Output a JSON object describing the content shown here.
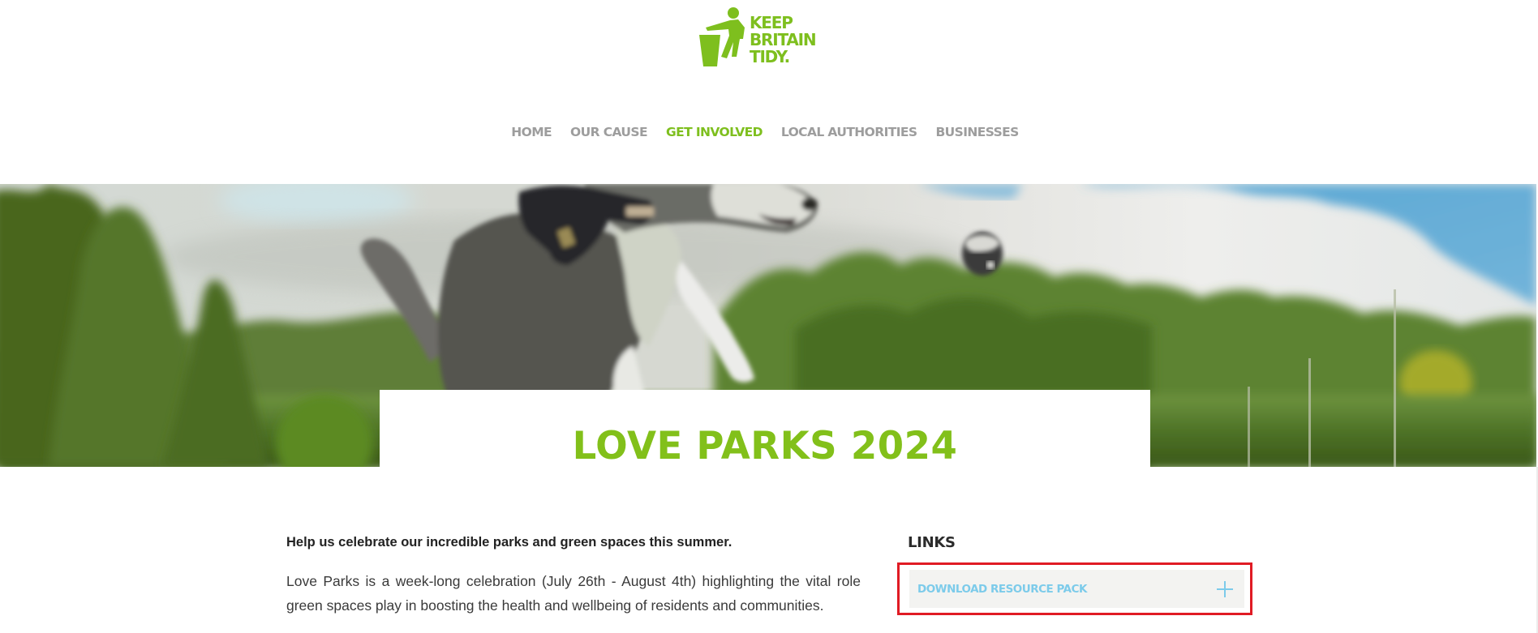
{
  "header": {
    "logo": {
      "alt": "Keep Britain Tidy",
      "lines": [
        "KEEP",
        "BRITAIN",
        "TIDY."
      ],
      "icon": "tidyman-bin-icon",
      "color": "#7ebf1e"
    },
    "nav": {
      "items": [
        {
          "label": "HOME",
          "active": false
        },
        {
          "label": "OUR CAUSE",
          "active": false
        },
        {
          "label": "GET INVOLVED",
          "active": true
        },
        {
          "label": "LOCAL AUTHORITIES",
          "active": false
        },
        {
          "label": "BUSINESSES",
          "active": false
        }
      ],
      "color": "#9d9d9d",
      "active_color": "#7ebf1e"
    }
  },
  "hero": {
    "image_alt": "Border collie leaping to catch a ball in a park with trees and cloudy sky",
    "title": "LOVE PARKS 2024",
    "title_color": "#82c01a"
  },
  "content": {
    "intro_strong": "Help us celebrate our incredible parks and green spaces this summer.",
    "intro_body": "Love Parks is a week-long celebration (July 26th - August 4th) highlighting the vital role green spaces play in boosting the health and wellbeing of residents and communities."
  },
  "sidebar": {
    "heading": "LINKS",
    "accordion": {
      "label": "DOWNLOAD RESOURCE PACK",
      "icon": "plus-icon",
      "expanded": false,
      "color": "#7ccbea"
    },
    "highlight_color": "#e01b24"
  }
}
